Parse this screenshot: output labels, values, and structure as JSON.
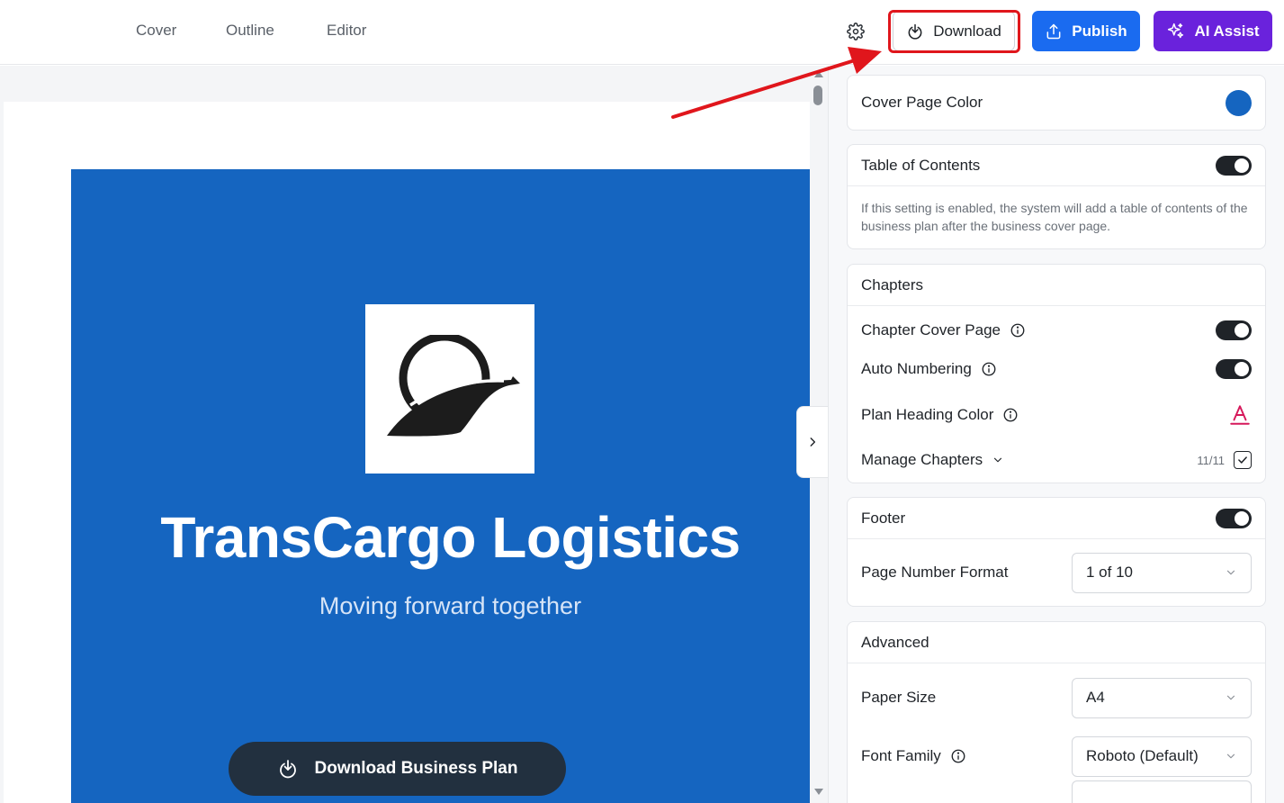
{
  "nav": {
    "tabs": [
      {
        "label": "Cover"
      },
      {
        "label": "Outline"
      },
      {
        "label": "Editor"
      }
    ]
  },
  "toolbar": {
    "download_label": "Download",
    "publish_label": "Publish",
    "ai_label": "AI Assist"
  },
  "cover": {
    "title": "TransCargo Logistics",
    "subtitle": "Moving forward together",
    "download_plan_label": "Download Business Plan",
    "color": "#1565c0"
  },
  "panel": {
    "cover_color": {
      "label": "Cover Page Color"
    },
    "toc": {
      "label": "Table of Contents",
      "enabled": true,
      "description": "If this setting is enabled, the system will add a table of contents of the business plan after the business cover page."
    },
    "chapters": {
      "title": "Chapters",
      "cover_page_label": "Chapter Cover Page",
      "cover_page_enabled": true,
      "auto_numbering_label": "Auto Numbering",
      "auto_numbering_enabled": true,
      "heading_color_label": "Plan Heading Color",
      "manage_label": "Manage Chapters",
      "count": "11/11"
    },
    "footer": {
      "label": "Footer",
      "enabled": true,
      "page_number_label": "Page Number Format",
      "page_number_value": "1 of 10"
    },
    "advanced": {
      "title": "Advanced",
      "paper_size_label": "Paper Size",
      "paper_size_value": "A4",
      "font_family_label": "Font Family",
      "font_family_value": "Roboto (Default)"
    }
  },
  "colors": {
    "accent_publish": "#1a6bf0",
    "accent_ai": "#6a22dc",
    "highlight": "#e0161c",
    "heading_color": "#d6185a"
  }
}
